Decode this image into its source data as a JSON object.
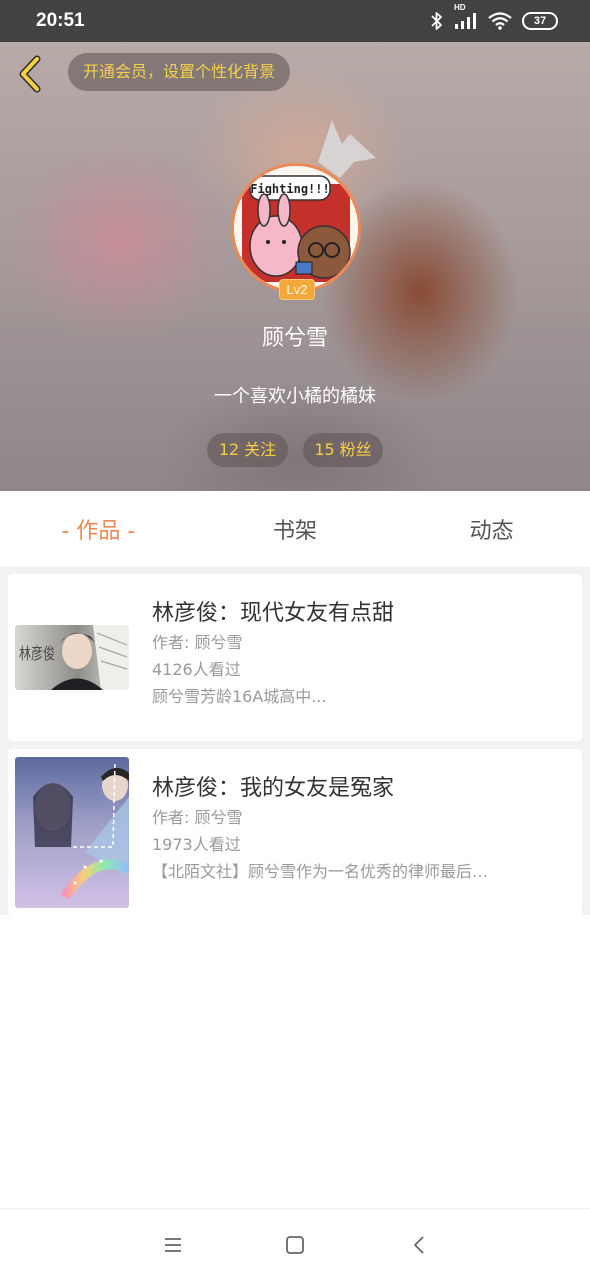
{
  "status_bar": {
    "time": "20:51",
    "network_label": "HD",
    "battery": "37",
    "icons": [
      "bluetooth-icon",
      "signal-icon",
      "wifi-icon",
      "battery-icon"
    ]
  },
  "header": {
    "vip_prompt": "开通会员，设置个性化背景",
    "avatar_text": "Fighting!!!",
    "level": "Lv2",
    "username": "顾兮雪",
    "bio": "一个喜欢小橘的橘妹",
    "following": {
      "count": "12",
      "label": "关注"
    },
    "followers": {
      "count": "15",
      "label": "粉丝"
    }
  },
  "tabs": [
    {
      "label": "- 作品 -",
      "active": true
    },
    {
      "label": "书架",
      "active": false
    },
    {
      "label": "动态",
      "active": false
    }
  ],
  "works": [
    {
      "title": "林彦俊：现代女友有点甜",
      "author": "作者: 顾兮雪",
      "views": "4126人看过",
      "summary": "顾兮雪芳龄16A城高中...",
      "cover_text": "林彦俊"
    },
    {
      "title": "林彦俊：我的女友是冤家",
      "author": "作者: 顾兮雪",
      "views": "1973人看过",
      "summary": "【北陌文社】顾兮雪作为一名优秀的律师最后…"
    }
  ],
  "colors": {
    "accent": "#e98a55",
    "gold": "#f6cf42",
    "status_bar": "#424242"
  },
  "nav_bar": [
    "menu-icon",
    "home-icon",
    "back-icon"
  ]
}
